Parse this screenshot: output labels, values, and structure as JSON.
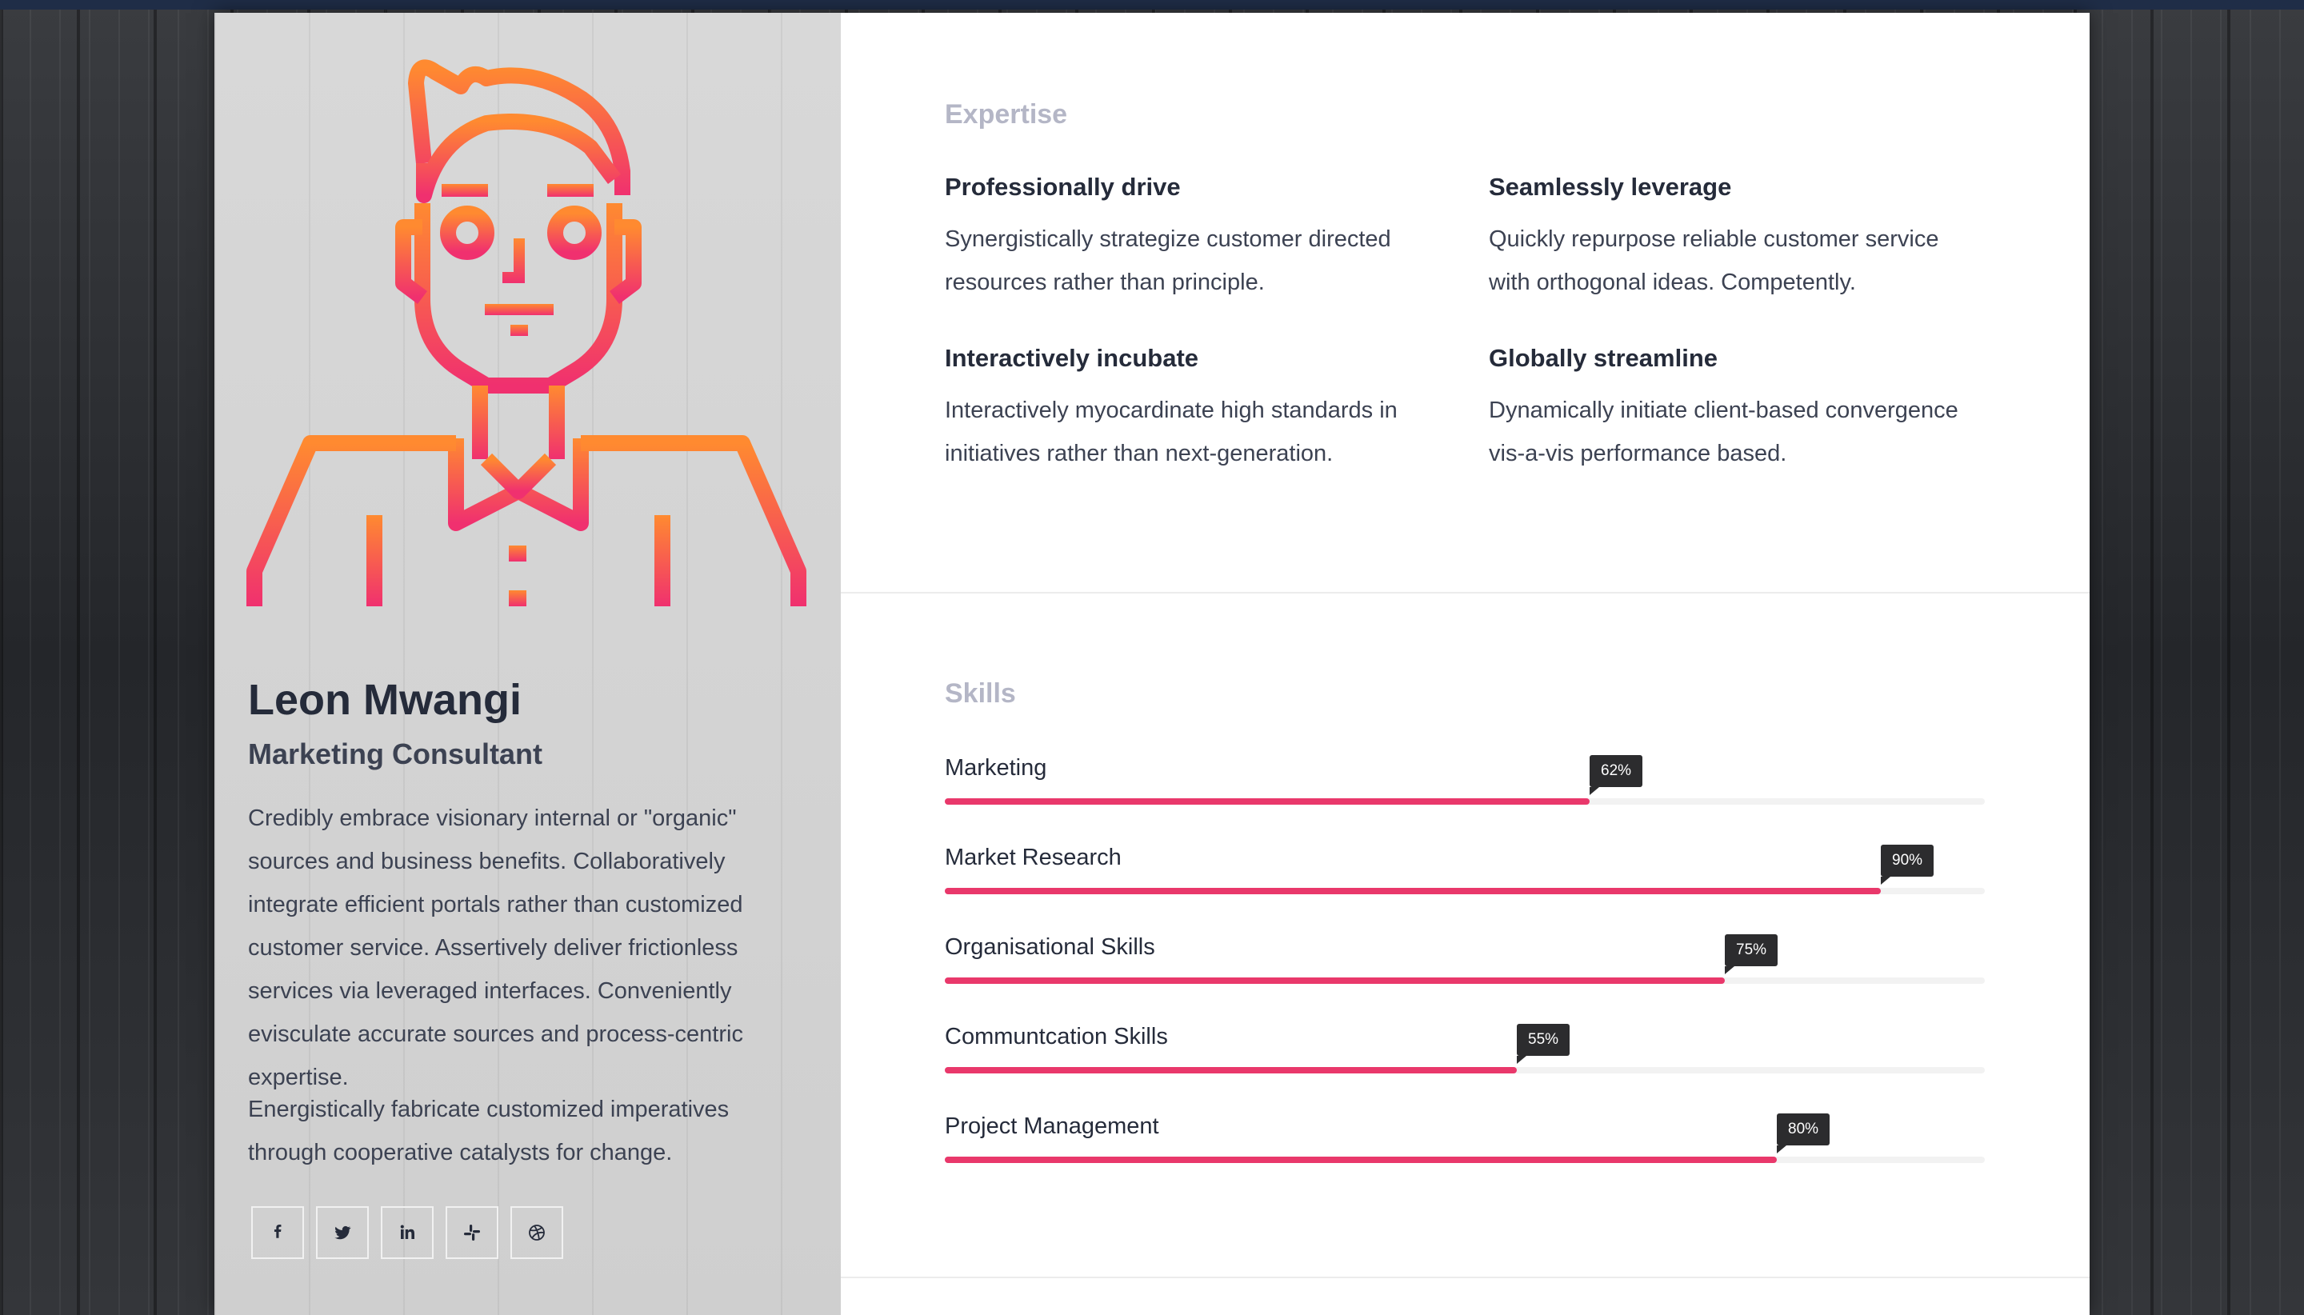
{
  "profile": {
    "name": "Leon Mwangi",
    "role": "Marketing Consultant",
    "bio_1": "Credibly embrace visionary internal or \"organic\" sources and business benefits. Collaboratively integrate efficient portals rather than customized customer service. Assertively deliver frictionless services via leveraged interfaces. Conveniently evisculate accurate sources and process-centric expertise.",
    "bio_2": "Energistically fabricate customized imperatives through cooperative catalysts for change."
  },
  "social": [
    {
      "name": "facebook-icon"
    },
    {
      "name": "twitter-icon"
    },
    {
      "name": "linkedin-icon"
    },
    {
      "name": "slack-icon"
    },
    {
      "name": "dribbble-icon"
    }
  ],
  "expertise": {
    "title": "Expertise",
    "items": [
      {
        "title": "Professionally drive",
        "text": "Synergistically strategize customer directed resources rather than principle."
      },
      {
        "title": "Seamlessly leverage",
        "text": "Quickly repurpose reliable customer service with orthogonal ideas. Competently."
      },
      {
        "title": "Interactively incubate",
        "text": "Interactively myocardinate high standards in initiatives rather than next-generation."
      },
      {
        "title": "Globally streamline",
        "text": "Dynamically initiate client-based convergence vis-a-vis performance based."
      }
    ]
  },
  "skills": {
    "title": "Skills",
    "items": [
      {
        "label": "Marketing",
        "percent": 62,
        "percent_label": "62%"
      },
      {
        "label": "Market Research",
        "percent": 90,
        "percent_label": "90%"
      },
      {
        "label": "Organisational Skills",
        "percent": 75,
        "percent_label": "75%"
      },
      {
        "label": "Communtcation Skills",
        "percent": 55,
        "percent_label": "55%"
      },
      {
        "label": "Project Management",
        "percent": 80,
        "percent_label": "80%"
      }
    ]
  },
  "colors": {
    "accent": "#e9386b",
    "avatar_gradient_start": "#ff8a30",
    "avatar_gradient_end": "#f0306f",
    "tooltip": "#2c2c2e"
  }
}
